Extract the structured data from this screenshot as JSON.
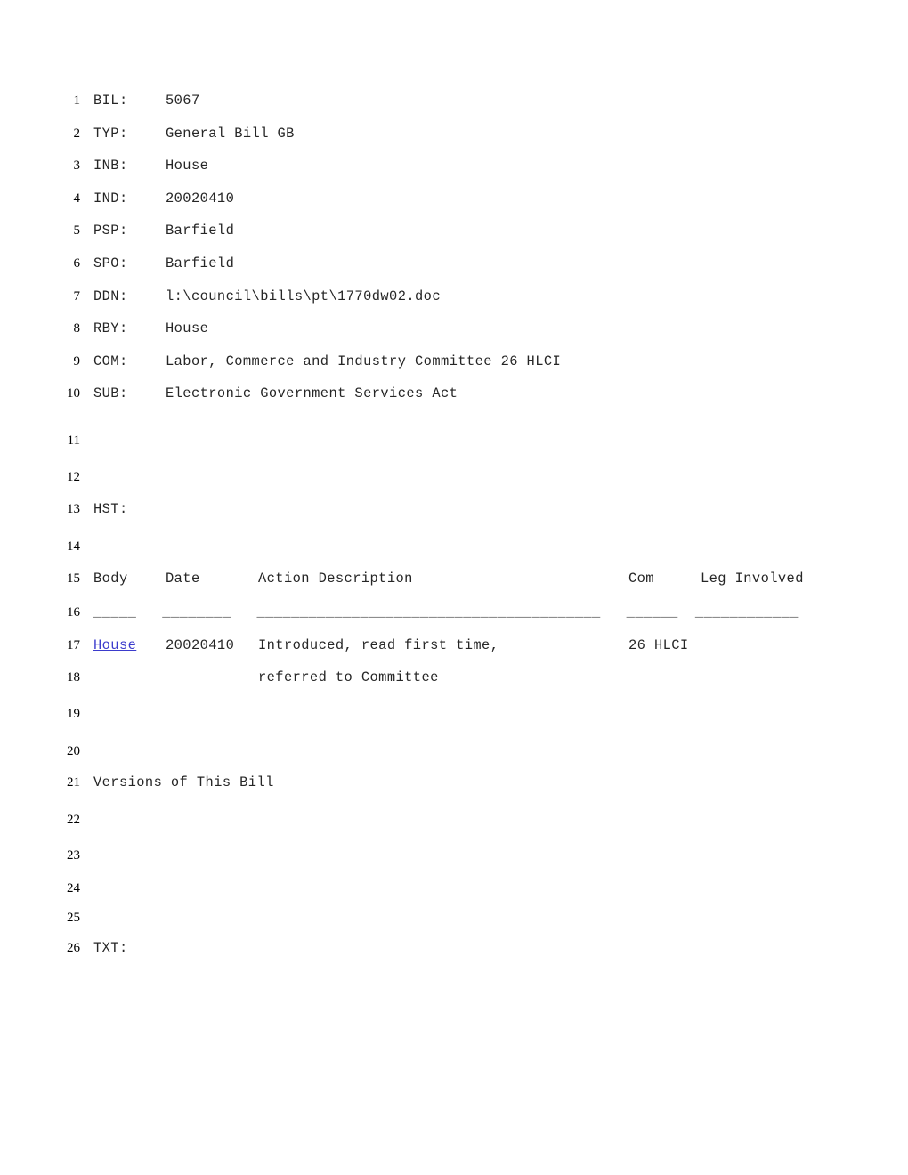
{
  "document": {
    "fields": [
      {
        "line": "1",
        "label": "BIL:",
        "value": "5067"
      },
      {
        "line": "2",
        "label": "TYP:",
        "value": "General Bill GB"
      },
      {
        "line": "3",
        "label": "INB:",
        "value": "House"
      },
      {
        "line": "4",
        "label": "IND:",
        "value": "20020410"
      },
      {
        "line": "5",
        "label": "PSP:",
        "value": "Barfield"
      },
      {
        "line": "6",
        "label": "SPO:",
        "value": "Barfield"
      },
      {
        "line": "7",
        "label": "DDN:",
        "value": "l:\\council\\bills\\pt\\1770dw02.doc"
      },
      {
        "line": "8",
        "label": "RBY:",
        "value": "House"
      },
      {
        "line": "9",
        "label": "COM:",
        "value": "Labor, Commerce and Industry Committee 26 HLCI"
      },
      {
        "line": "10",
        "label": "SUB:",
        "value": "Electronic Government Services Act"
      }
    ],
    "history": {
      "line_blank_11": "11",
      "line_blank_12": "12",
      "line_hst": "13",
      "hst_label": "HST:",
      "line_blank_14": "14",
      "line_header": "15",
      "header": {
        "body": "Body",
        "date": "Date",
        "action": "Action Description",
        "com": "Com",
        "leg": "Leg Involved"
      },
      "line_rule": "16",
      "rule": "_____   ________   ________________________________________   ______  ____________",
      "line_row1": "17",
      "line_row2": "18",
      "row": {
        "body": "House",
        "date": "20020410",
        "action_line1": "Introduced, read first time,",
        "action_line2": "referred to Committee",
        "com": "26 HLCI",
        "leg": ""
      }
    },
    "versions": {
      "line_blank_19": "19",
      "line_blank_20": "20",
      "line_versions": "21",
      "heading": "Versions of This Bill",
      "line_blank_22": "22",
      "line_blank_23": "23",
      "line_blank_24": "24",
      "line_blank_25": "25",
      "line_txt": "26",
      "txt_label": "TXT:"
    }
  },
  "colors": {
    "text": "#262626",
    "lineno": "#000000",
    "link": "#3b3bcc",
    "rule": "#555555",
    "background": "#ffffff"
  }
}
